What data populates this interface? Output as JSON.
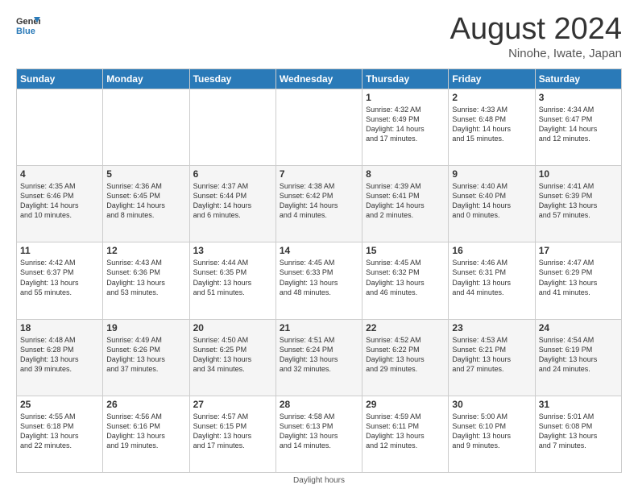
{
  "logo": {
    "general": "General",
    "blue": "Blue"
  },
  "header": {
    "title": "August 2024",
    "subtitle": "Ninohe, Iwate, Japan"
  },
  "weekdays": [
    "Sunday",
    "Monday",
    "Tuesday",
    "Wednesday",
    "Thursday",
    "Friday",
    "Saturday"
  ],
  "footer": {
    "daylight_label": "Daylight hours"
  },
  "weeks": [
    [
      {
        "day": "",
        "info": ""
      },
      {
        "day": "",
        "info": ""
      },
      {
        "day": "",
        "info": ""
      },
      {
        "day": "",
        "info": ""
      },
      {
        "day": "1",
        "info": "Sunrise: 4:32 AM\nSunset: 6:49 PM\nDaylight: 14 hours\nand 17 minutes."
      },
      {
        "day": "2",
        "info": "Sunrise: 4:33 AM\nSunset: 6:48 PM\nDaylight: 14 hours\nand 15 minutes."
      },
      {
        "day": "3",
        "info": "Sunrise: 4:34 AM\nSunset: 6:47 PM\nDaylight: 14 hours\nand 12 minutes."
      }
    ],
    [
      {
        "day": "4",
        "info": "Sunrise: 4:35 AM\nSunset: 6:46 PM\nDaylight: 14 hours\nand 10 minutes."
      },
      {
        "day": "5",
        "info": "Sunrise: 4:36 AM\nSunset: 6:45 PM\nDaylight: 14 hours\nand 8 minutes."
      },
      {
        "day": "6",
        "info": "Sunrise: 4:37 AM\nSunset: 6:44 PM\nDaylight: 14 hours\nand 6 minutes."
      },
      {
        "day": "7",
        "info": "Sunrise: 4:38 AM\nSunset: 6:42 PM\nDaylight: 14 hours\nand 4 minutes."
      },
      {
        "day": "8",
        "info": "Sunrise: 4:39 AM\nSunset: 6:41 PM\nDaylight: 14 hours\nand 2 minutes."
      },
      {
        "day": "9",
        "info": "Sunrise: 4:40 AM\nSunset: 6:40 PM\nDaylight: 14 hours\nand 0 minutes."
      },
      {
        "day": "10",
        "info": "Sunrise: 4:41 AM\nSunset: 6:39 PM\nDaylight: 13 hours\nand 57 minutes."
      }
    ],
    [
      {
        "day": "11",
        "info": "Sunrise: 4:42 AM\nSunset: 6:37 PM\nDaylight: 13 hours\nand 55 minutes."
      },
      {
        "day": "12",
        "info": "Sunrise: 4:43 AM\nSunset: 6:36 PM\nDaylight: 13 hours\nand 53 minutes."
      },
      {
        "day": "13",
        "info": "Sunrise: 4:44 AM\nSunset: 6:35 PM\nDaylight: 13 hours\nand 51 minutes."
      },
      {
        "day": "14",
        "info": "Sunrise: 4:45 AM\nSunset: 6:33 PM\nDaylight: 13 hours\nand 48 minutes."
      },
      {
        "day": "15",
        "info": "Sunrise: 4:45 AM\nSunset: 6:32 PM\nDaylight: 13 hours\nand 46 minutes."
      },
      {
        "day": "16",
        "info": "Sunrise: 4:46 AM\nSunset: 6:31 PM\nDaylight: 13 hours\nand 44 minutes."
      },
      {
        "day": "17",
        "info": "Sunrise: 4:47 AM\nSunset: 6:29 PM\nDaylight: 13 hours\nand 41 minutes."
      }
    ],
    [
      {
        "day": "18",
        "info": "Sunrise: 4:48 AM\nSunset: 6:28 PM\nDaylight: 13 hours\nand 39 minutes."
      },
      {
        "day": "19",
        "info": "Sunrise: 4:49 AM\nSunset: 6:26 PM\nDaylight: 13 hours\nand 37 minutes."
      },
      {
        "day": "20",
        "info": "Sunrise: 4:50 AM\nSunset: 6:25 PM\nDaylight: 13 hours\nand 34 minutes."
      },
      {
        "day": "21",
        "info": "Sunrise: 4:51 AM\nSunset: 6:24 PM\nDaylight: 13 hours\nand 32 minutes."
      },
      {
        "day": "22",
        "info": "Sunrise: 4:52 AM\nSunset: 6:22 PM\nDaylight: 13 hours\nand 29 minutes."
      },
      {
        "day": "23",
        "info": "Sunrise: 4:53 AM\nSunset: 6:21 PM\nDaylight: 13 hours\nand 27 minutes."
      },
      {
        "day": "24",
        "info": "Sunrise: 4:54 AM\nSunset: 6:19 PM\nDaylight: 13 hours\nand 24 minutes."
      }
    ],
    [
      {
        "day": "25",
        "info": "Sunrise: 4:55 AM\nSunset: 6:18 PM\nDaylight: 13 hours\nand 22 minutes."
      },
      {
        "day": "26",
        "info": "Sunrise: 4:56 AM\nSunset: 6:16 PM\nDaylight: 13 hours\nand 19 minutes."
      },
      {
        "day": "27",
        "info": "Sunrise: 4:57 AM\nSunset: 6:15 PM\nDaylight: 13 hours\nand 17 minutes."
      },
      {
        "day": "28",
        "info": "Sunrise: 4:58 AM\nSunset: 6:13 PM\nDaylight: 13 hours\nand 14 minutes."
      },
      {
        "day": "29",
        "info": "Sunrise: 4:59 AM\nSunset: 6:11 PM\nDaylight: 13 hours\nand 12 minutes."
      },
      {
        "day": "30",
        "info": "Sunrise: 5:00 AM\nSunset: 6:10 PM\nDaylight: 13 hours\nand 9 minutes."
      },
      {
        "day": "31",
        "info": "Sunrise: 5:01 AM\nSunset: 6:08 PM\nDaylight: 13 hours\nand 7 minutes."
      }
    ]
  ]
}
